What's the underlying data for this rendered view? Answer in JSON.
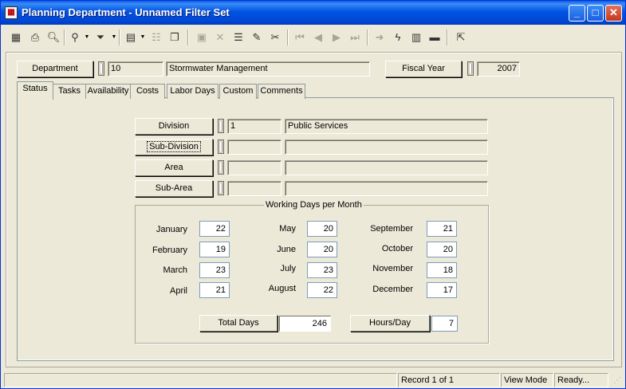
{
  "window": {
    "title": "Planning Department - Unnamed Filter Set",
    "controls": {
      "minimize": "_",
      "maximize": "□",
      "close": "✕"
    }
  },
  "toolbar": {
    "icons": [
      "grid-icon",
      "print-icon",
      "print-preview-icon",
      "find-icon",
      "filter-icon",
      "new-record-icon",
      "properties-icon",
      "copy-icon",
      "save-icon",
      "delete-icon",
      "stack-icon",
      "edit-icon",
      "cut-icon",
      "first-record-icon",
      "prev-record-icon",
      "next-record-icon",
      "last-record-icon",
      "goto-icon",
      "lightning-icon",
      "chart-icon",
      "briefcase-icon",
      "exit-icon"
    ]
  },
  "header": {
    "department": {
      "label": "Department",
      "code": "10",
      "name": "Stormwater Management"
    },
    "fiscal_year": {
      "label": "Fiscal Year",
      "value": "2007"
    }
  },
  "tabs": [
    {
      "label": "Status",
      "active": true
    },
    {
      "label": "Tasks"
    },
    {
      "label": "Availability"
    },
    {
      "label": "Costs"
    },
    {
      "label": "Labor Days"
    },
    {
      "label": "Custom"
    },
    {
      "label": "Comments"
    }
  ],
  "org": {
    "division": {
      "label": "Division",
      "code": "1",
      "name": "Public Services"
    },
    "subdivision": {
      "label": "Sub-Division",
      "code": "",
      "name": ""
    },
    "area": {
      "label": "Area",
      "code": "",
      "name": ""
    },
    "subarea": {
      "label": "Sub-Area",
      "code": "",
      "name": ""
    }
  },
  "working_days": {
    "title": "Working Days per Month",
    "months": [
      {
        "name": "January",
        "days": "22"
      },
      {
        "name": "February",
        "days": "19"
      },
      {
        "name": "March",
        "days": "23"
      },
      {
        "name": "April",
        "days": "21"
      },
      {
        "name": "May",
        "days": "20"
      },
      {
        "name": "June",
        "days": "20"
      },
      {
        "name": "July",
        "days": "23"
      },
      {
        "name": "August",
        "days": "22"
      },
      {
        "name": "September",
        "days": "21"
      },
      {
        "name": "October",
        "days": "20"
      },
      {
        "name": "November",
        "days": "18"
      },
      {
        "name": "December",
        "days": "17"
      }
    ],
    "total_label": "Total Days",
    "total_value": "246",
    "hours_label": "Hours/Day",
    "hours_value": "7"
  },
  "status": {
    "record": "Record 1 of 1",
    "mode": "View Mode",
    "state": "Ready..."
  }
}
